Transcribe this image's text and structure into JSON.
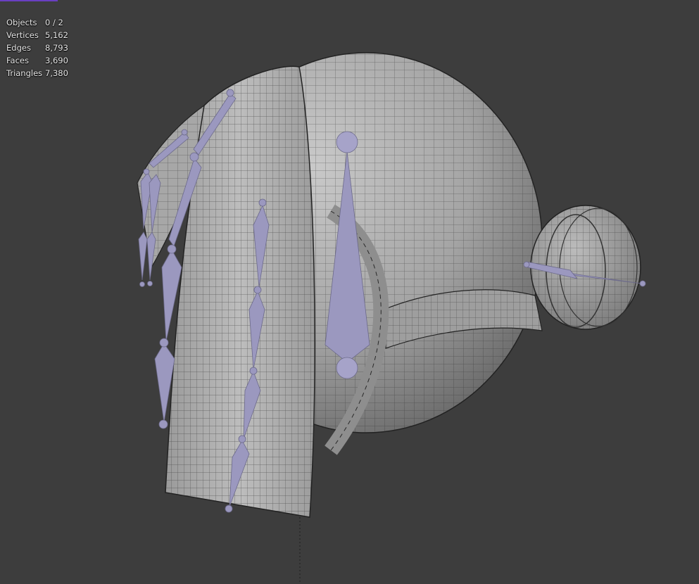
{
  "stats": {
    "rows": [
      {
        "label": "Objects",
        "value": "0 / 2"
      },
      {
        "label": "Vertices",
        "value": "5,162"
      },
      {
        "label": "Edges",
        "value": "8,793"
      },
      {
        "label": "Faces",
        "value": "3,690"
      },
      {
        "label": "Triangles",
        "value": "7,380"
      }
    ]
  },
  "colors": {
    "background": "#3d3d3d",
    "mesh": "#a9a9a9",
    "wire": "#2a2a2a",
    "bone": "#9b98bf",
    "accent": "#6a3fc2"
  }
}
